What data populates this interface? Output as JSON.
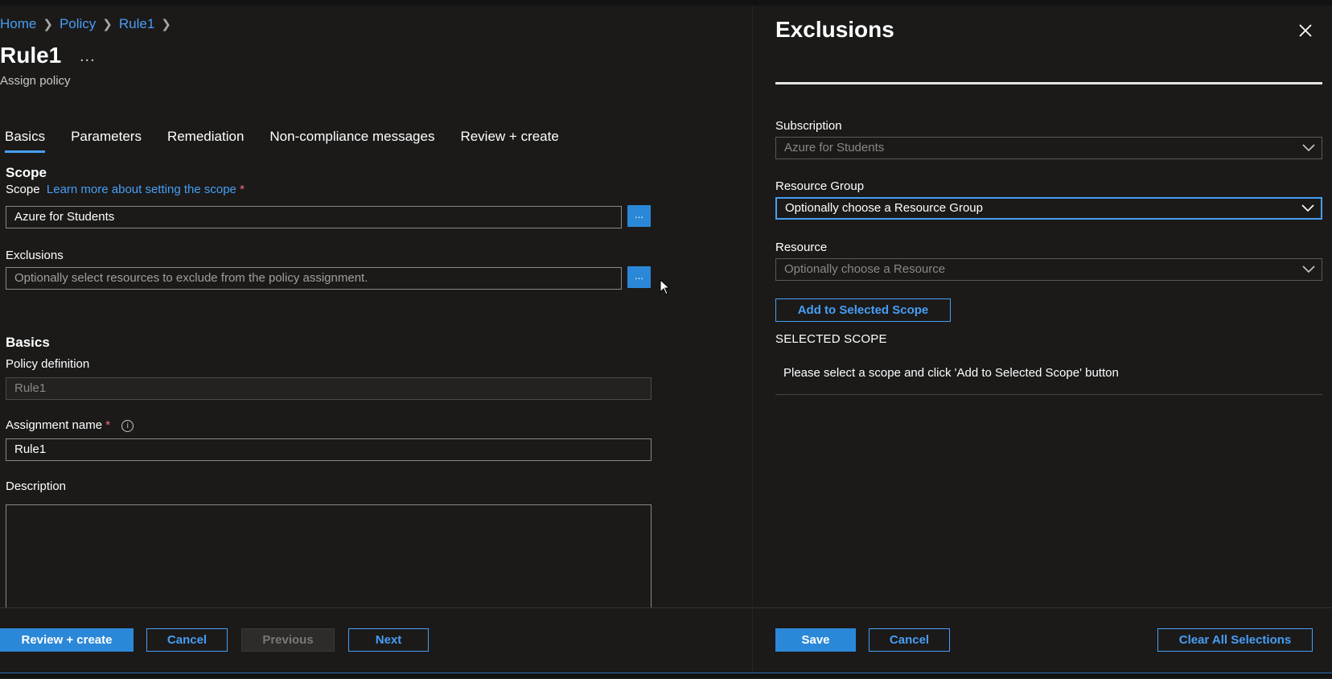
{
  "breadcrumb": {
    "items": [
      "Home",
      "Policy",
      "Rule1"
    ]
  },
  "page": {
    "title": "Rule1",
    "more": "...",
    "subtitle": "Assign policy"
  },
  "tabs": [
    "Basics",
    "Parameters",
    "Remediation",
    "Non-compliance messages",
    "Review + create"
  ],
  "scope_section": {
    "heading": "Scope",
    "scope_label": "Scope",
    "learn_more": "Learn more about setting the scope",
    "required_mark": "*",
    "scope_value": "Azure for Students",
    "browse_label": "...",
    "exclusions_label": "Exclusions",
    "exclusions_placeholder": "Optionally select resources to exclude from the policy assignment."
  },
  "basics_section": {
    "heading": "Basics",
    "policy_definition_label": "Policy definition",
    "policy_definition_value": "Rule1",
    "assignment_name_label": "Assignment name",
    "assignment_name_value": "Rule1",
    "info_glyph": "i",
    "description_label": "Description"
  },
  "footer": {
    "review_create": "Review + create",
    "cancel": "Cancel",
    "previous": "Previous",
    "next": "Next"
  },
  "exclusions_panel": {
    "title": "Exclusions",
    "subscription_label": "Subscription",
    "subscription_value": "Azure for Students",
    "resource_group_label": "Resource Group",
    "resource_group_value": "Optionally choose a Resource Group",
    "resource_label": "Resource",
    "resource_placeholder": "Optionally choose a Resource",
    "add_button": "Add to Selected Scope",
    "selected_scope_heading": "SELECTED SCOPE",
    "selected_scope_message": "Please select a scope and click 'Add to Selected Scope' button",
    "save": "Save",
    "cancel": "Cancel",
    "clear_all": "Clear All Selections"
  },
  "colors": {
    "accent": "#479ef5",
    "primary_button": "#2b88d8",
    "background": "#1b1a19",
    "required": "#f1707b"
  }
}
